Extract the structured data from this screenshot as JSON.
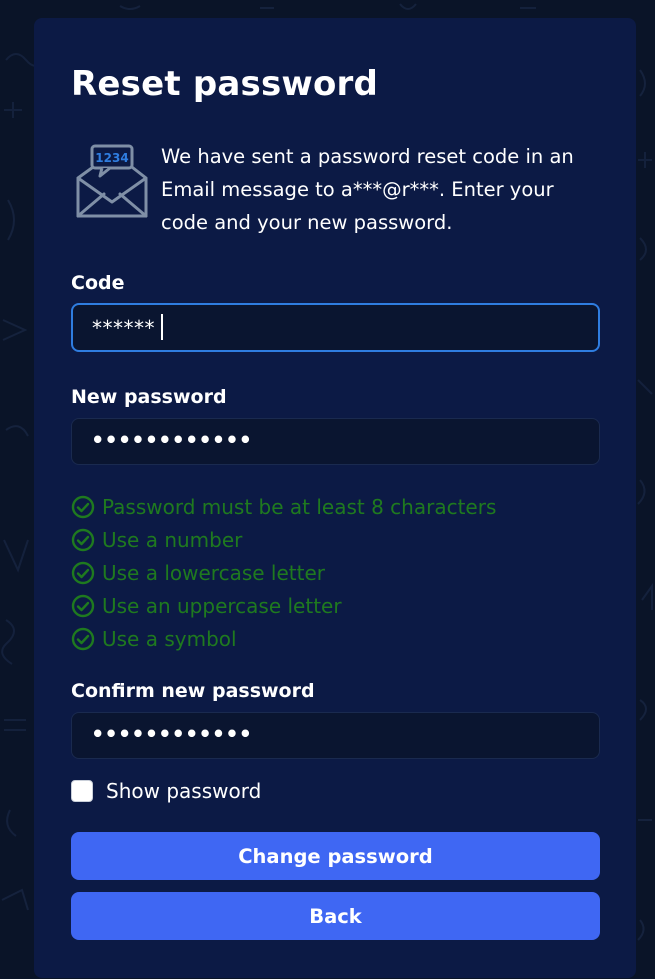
{
  "page": {
    "title": "Reset password"
  },
  "info": {
    "icon": "envelope-code-icon",
    "icon_code": "1234",
    "message": "We have sent a password reset code in an Email message to a***@r***. Enter your code and your new password."
  },
  "code_field": {
    "label": "Code",
    "value": "******",
    "focused": true
  },
  "new_password_field": {
    "label": "New password",
    "masked_value": "••••••••••••"
  },
  "password_rules": [
    {
      "text": "Password must be at least 8 characters",
      "satisfied": true
    },
    {
      "text": "Use a number",
      "satisfied": true
    },
    {
      "text": "Use a lowercase letter",
      "satisfied": true
    },
    {
      "text": "Use an uppercase letter",
      "satisfied": true
    },
    {
      "text": "Use a symbol",
      "satisfied": true
    }
  ],
  "confirm_password_field": {
    "label": "Confirm new password",
    "masked_value": "••••••••••••"
  },
  "show_password": {
    "label": "Show password",
    "checked": false
  },
  "buttons": {
    "change_password": "Change password",
    "back": "Back"
  },
  "colors": {
    "page_background": "#0a1428",
    "card_background": "#0c1a45",
    "field_background": "#0a1530",
    "focus_border": "#2f7de0",
    "rule_success": "#1f7a1f",
    "primary_button": "#3f67f3",
    "icon_accent": "#2f7de0",
    "icon_outline": "#7f8fa6"
  }
}
